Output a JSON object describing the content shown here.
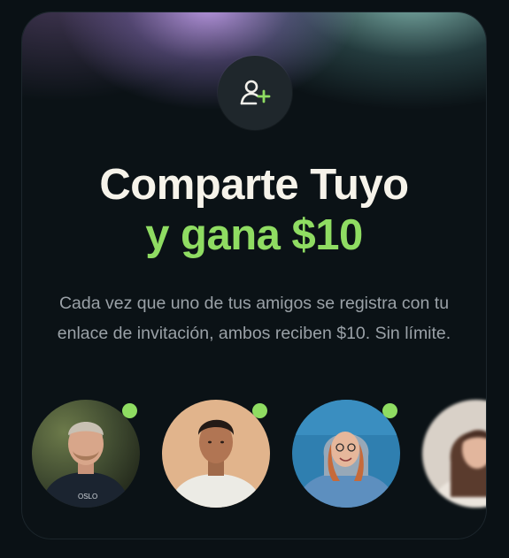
{
  "referral": {
    "title_line1": "Comparte Tuyo",
    "title_line2": "y gana $10",
    "description": "Cada vez que uno de tus amigos se registra con tu enlace de invitación, ambos reciben $10. Sin límite.",
    "icon": "user-plus-icon"
  },
  "friends": [
    {
      "name": "friend-1",
      "online": true
    },
    {
      "name": "friend-2",
      "online": true
    },
    {
      "name": "friend-3",
      "online": true
    },
    {
      "name": "friend-4",
      "online": false
    }
  ],
  "colors": {
    "accent": "#8fdc62",
    "title": "#f6f3ea",
    "background": "#0b1216",
    "body_text": "#9aa1a7"
  }
}
